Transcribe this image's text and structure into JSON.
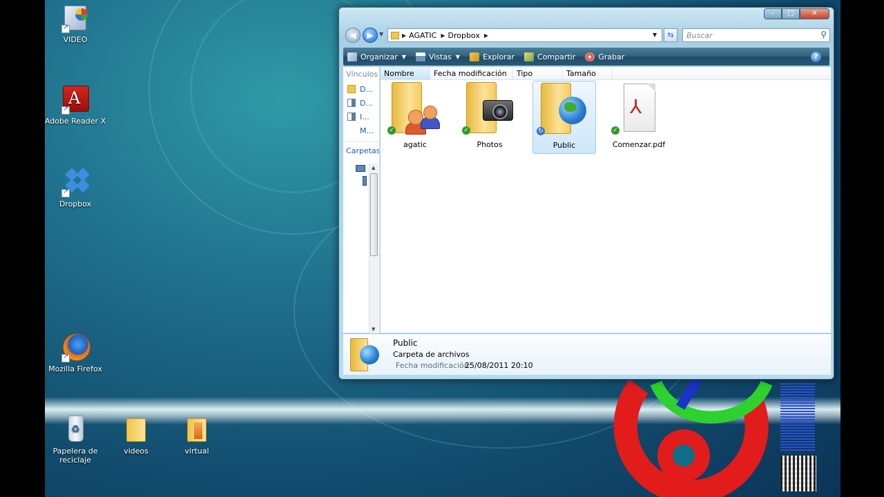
{
  "desktop": {
    "icons": [
      {
        "label": "VIDEO"
      },
      {
        "label": "Adobe Reader X"
      },
      {
        "label": "Dropbox"
      },
      {
        "label": "Mozilla Firefox"
      },
      {
        "label": "Papelera de reciclaje"
      },
      {
        "label": "videos"
      },
      {
        "label": "virtual"
      }
    ]
  },
  "window": {
    "buttons": {
      "minimize": "–",
      "maximize": "□",
      "close": "✕"
    },
    "address": {
      "crumbs": [
        "AGATIC",
        "Dropbox"
      ]
    },
    "search": {
      "placeholder": "Buscar"
    },
    "toolbar": {
      "organize": "Organizar",
      "views": "Vistas",
      "explore": "Explorar",
      "share": "Compartir",
      "burn": "Grabar"
    },
    "nav": {
      "links_header": "Vínculos",
      "items": [
        "D...",
        "D...",
        "I...",
        "M..."
      ],
      "folders_header": "Carpetas"
    },
    "columns": [
      "Nombre",
      "Fecha modificación",
      "Tipo",
      "Tamaño"
    ],
    "files": [
      {
        "name": "agatic",
        "status": "ok"
      },
      {
        "name": "Photos",
        "status": "ok"
      },
      {
        "name": "Public",
        "status": "sync"
      },
      {
        "name": "Comenzar.pdf",
        "status": "ok"
      }
    ],
    "details": {
      "name": "Public",
      "type": "Carpeta de archivos",
      "modified_label": "Fecha modificación:",
      "modified_value": "25/08/2011 20:10"
    }
  },
  "colors": {
    "accent_red": "#e21b1b",
    "accent_green": "#2ed12e",
    "accent_blue": "#1a33c8"
  }
}
